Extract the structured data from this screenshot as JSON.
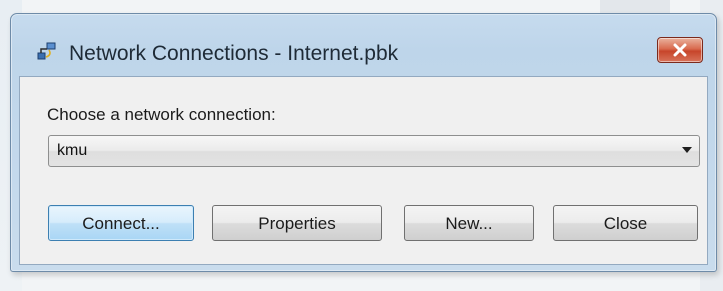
{
  "window": {
    "title": "Network Connections - Internet.pbk"
  },
  "form": {
    "choose_label": "Choose a network connection:",
    "selected_connection": "kmu"
  },
  "buttons": {
    "connect": "Connect...",
    "properties": "Properties",
    "new": "New...",
    "close": "Close"
  },
  "icons": {
    "app": "network-connection-icon",
    "close": "close-icon",
    "dropdown": "chevron-down-icon"
  },
  "colors": {
    "title_bar": "#c6dbee",
    "close_button": "#d96a4e",
    "default_button_border": "#3c7fb1"
  }
}
